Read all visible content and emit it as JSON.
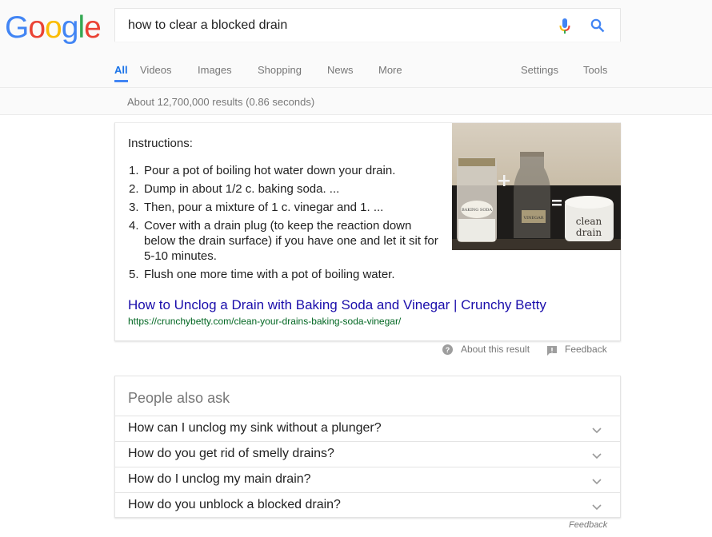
{
  "logo": {
    "letters": [
      "G",
      "o",
      "o",
      "g",
      "l",
      "e"
    ],
    "colors": [
      "#4285f4",
      "#ea4335",
      "#fbbc05",
      "#4285f4",
      "#34a853",
      "#ea4335"
    ]
  },
  "search": {
    "query": "how to clear a blocked drain",
    "mic_icon": "microphone-icon",
    "search_icon": "magnifier-icon"
  },
  "tabs": {
    "all": "All",
    "videos": "Videos",
    "images": "Images",
    "shopping": "Shopping",
    "news": "News",
    "more": "More",
    "settings": "Settings",
    "tools": "Tools"
  },
  "stats": "About 12,700,000 results (0.86 seconds)",
  "featured": {
    "title": "Instructions:",
    "steps": [
      {
        "num": "1.",
        "text": "Pour a pot of boiling hot water down your drain."
      },
      {
        "num": "2.",
        "text": "Dump in about 1/2 c. baking soda. ..."
      },
      {
        "num": "3.",
        "text": "Then, pour a mixture of 1 c. vinegar and 1. ..."
      },
      {
        "num": "4.",
        "text": "Cover with a drain plug (to keep the reaction down below the drain surface) if you have one and let it sit for 5-10 minutes."
      },
      {
        "num": "5.",
        "text": "Flush one more time with a pot of boiling water."
      }
    ],
    "image": {
      "label_jar": "BAKING SODA",
      "label_bottle": "VINEGAR",
      "label_bowl_1": "clean",
      "label_bowl_2": "drain",
      "plus": "+",
      "equals": "="
    },
    "link": "How to Unclog a Drain with Baking Soda and Vinegar | Crunchy Betty",
    "url": "https://crunchybetty.com/clean-your-drains-baking-soda-vinegar/",
    "about": "About this result",
    "feedback": "Feedback"
  },
  "paa": {
    "title": "People also ask",
    "questions": [
      "How can I unclog my sink without a plunger?",
      "How do you get rid of smelly drains?",
      "How do I unclog my main drain?",
      "How do you unblock a blocked drain?"
    ],
    "feedback": "Feedback"
  }
}
